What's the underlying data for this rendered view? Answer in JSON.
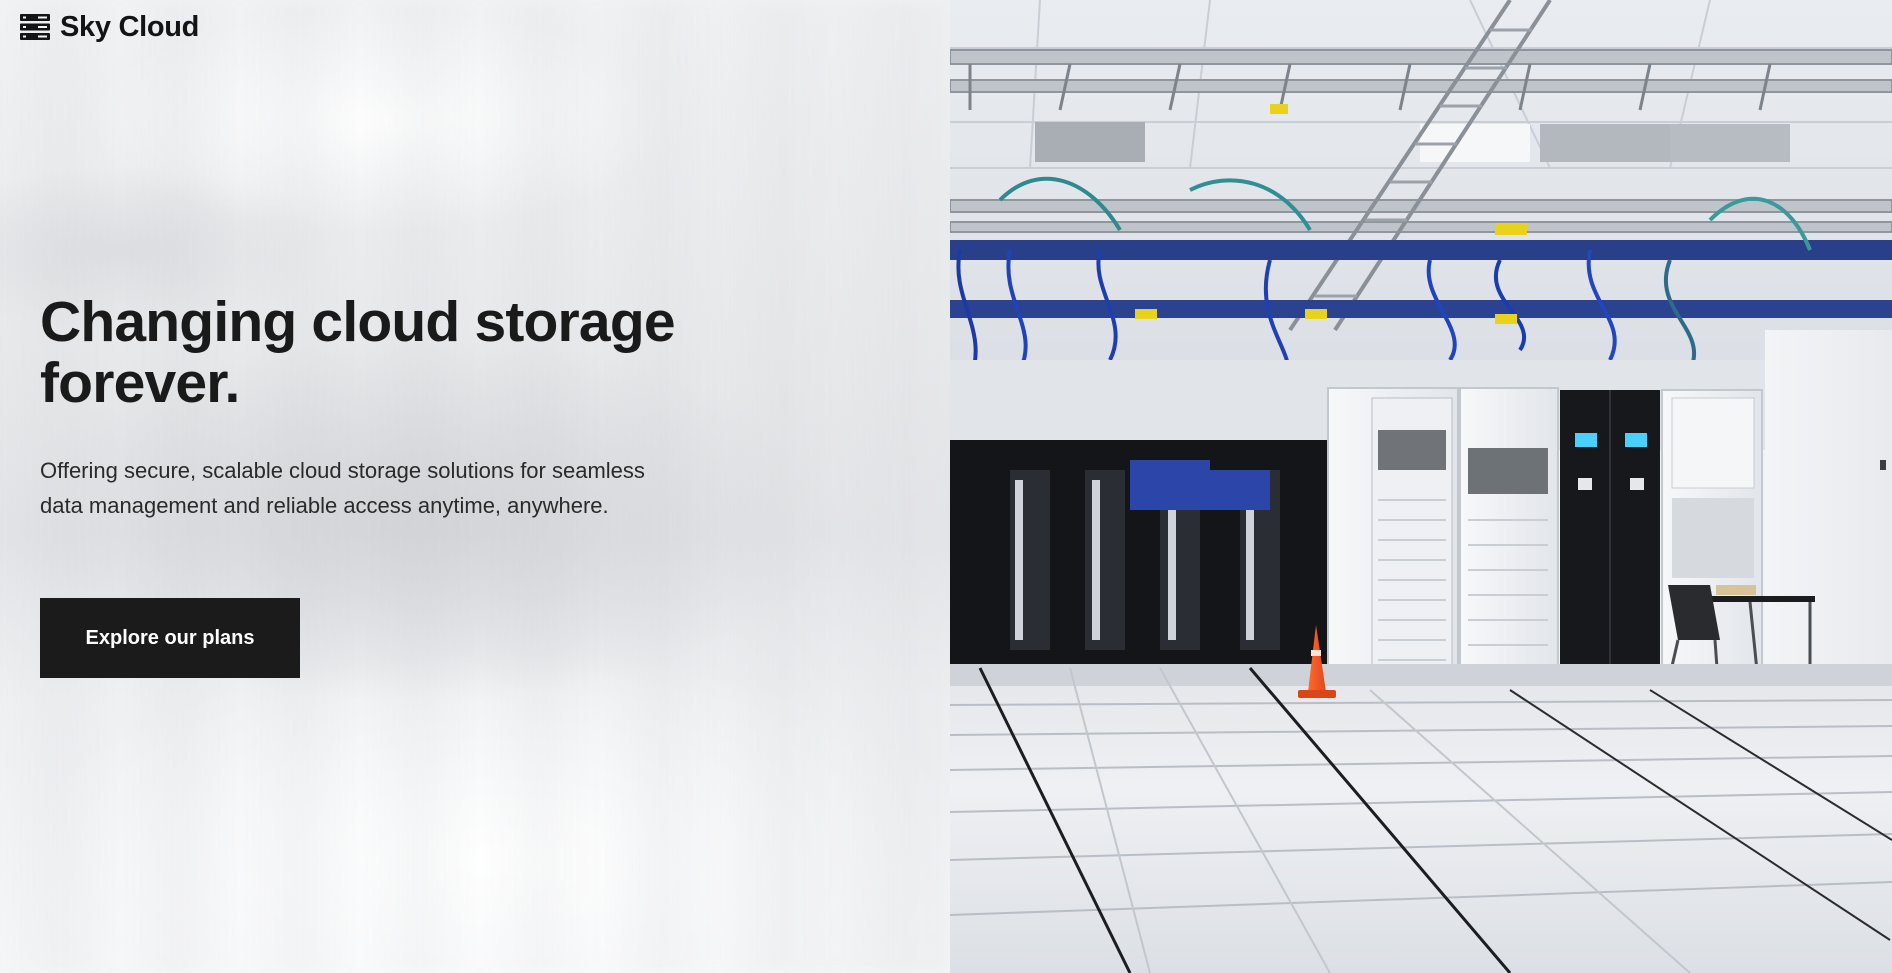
{
  "brand": {
    "name": "Sky Cloud",
    "icon": "server-rack-icon"
  },
  "hero": {
    "title": "Changing cloud storage forever.",
    "subtitle": "Offering secure, scalable cloud storage solutions for seamless data management and reliable access anytime, anywhere.",
    "cta_label": "Explore our plans"
  },
  "colors": {
    "button_bg": "#1b1b1b",
    "button_text": "#ffffff",
    "text": "#1a1a1a"
  },
  "image": {
    "subject": "data-center-photo"
  }
}
